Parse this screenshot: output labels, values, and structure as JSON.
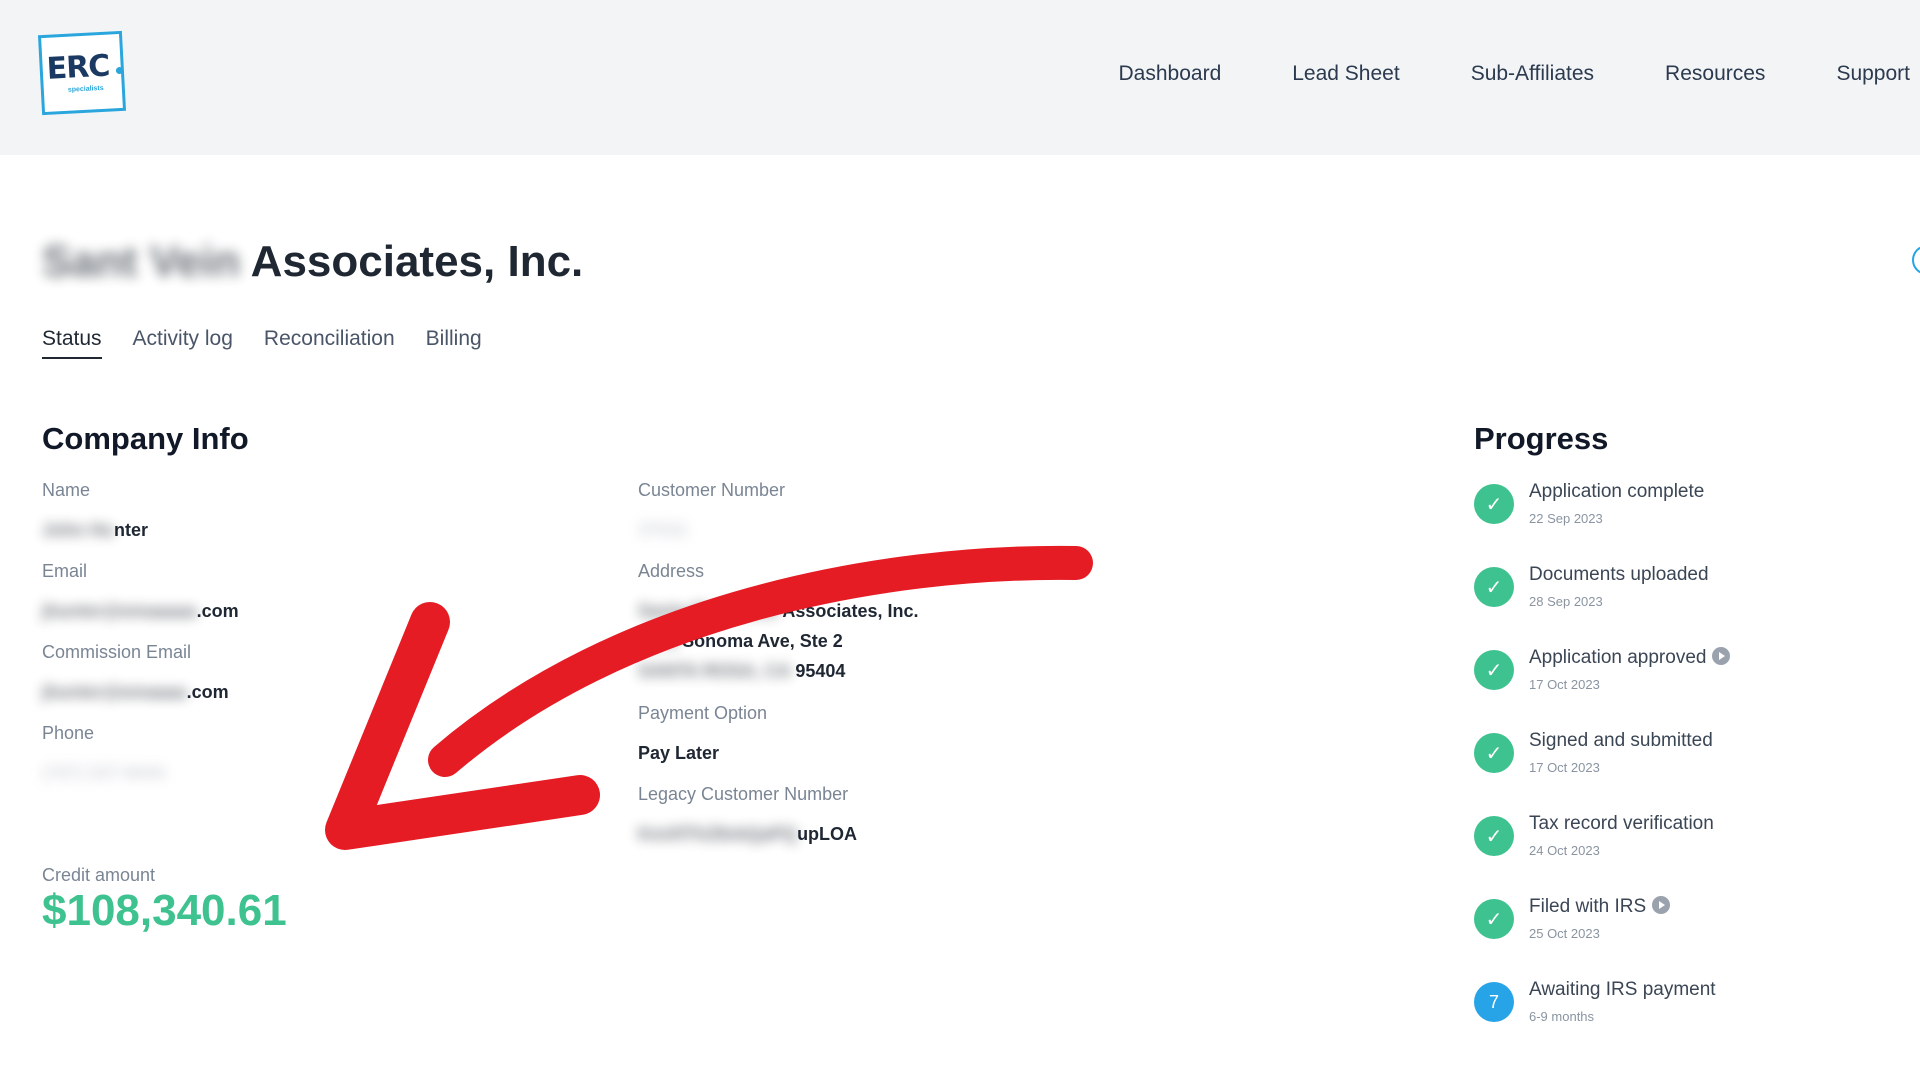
{
  "header": {
    "logo_word": "ERC",
    "logo_sub": "specialists",
    "nav": [
      "Dashboard",
      "Lead Sheet",
      "Sub-Affiliates",
      "Resources",
      "Support"
    ]
  },
  "page": {
    "title_visible": "Associates, Inc.",
    "title_blurred": "Sant Vein",
    "tabs": [
      "Status",
      "Activity log",
      "Reconciliation",
      "Billing"
    ],
    "active_tab": "Status"
  },
  "company_info": {
    "heading": "Company Info",
    "name_label": "Name",
    "name_value_visible": "nter",
    "email_label": "Email",
    "email_value_visible": ".com",
    "commission_email_label": "Commission Email",
    "commission_email_value_visible": ".com",
    "phone_label": "Phone",
    "customer_number_label": "Customer Number",
    "address_label": "Address",
    "address_line1_visible": "Associates, Inc.",
    "address_line2_visible": "Sonoma Ave, Ste 2",
    "address_line3_visible": "95404",
    "payment_option_label": "Payment Option",
    "payment_option_value": "Pay Later",
    "legacy_label": "Legacy Customer Number",
    "legacy_value_visible": "upLOA",
    "credit_label": "Credit amount",
    "credit_amount": "$108,340.61"
  },
  "progress": {
    "heading": "Progress",
    "steps": [
      {
        "title": "Application complete",
        "date": "22 Sep 2023",
        "state": "done"
      },
      {
        "title": "Documents uploaded",
        "date": "28 Sep 2023",
        "state": "done"
      },
      {
        "title": "Application approved",
        "date": "17 Oct 2023",
        "state": "done",
        "info": true
      },
      {
        "title": "Signed and submitted",
        "date": "17 Oct 2023",
        "state": "done"
      },
      {
        "title": "Tax record verification",
        "date": "24 Oct 2023",
        "state": "done"
      },
      {
        "title": "Filed with IRS",
        "date": "25 Oct 2023",
        "state": "done",
        "info": true
      },
      {
        "title": "Awaiting IRS payment",
        "date": "6-9 months",
        "state": "pending",
        "badge": "7"
      }
    ]
  },
  "colors": {
    "accent_green": "#3ec28f",
    "accent_blue": "#27a4e8",
    "annotation_red": "#e51c24"
  },
  "icons": {
    "check": "check-icon",
    "info": "play-circle-icon"
  }
}
